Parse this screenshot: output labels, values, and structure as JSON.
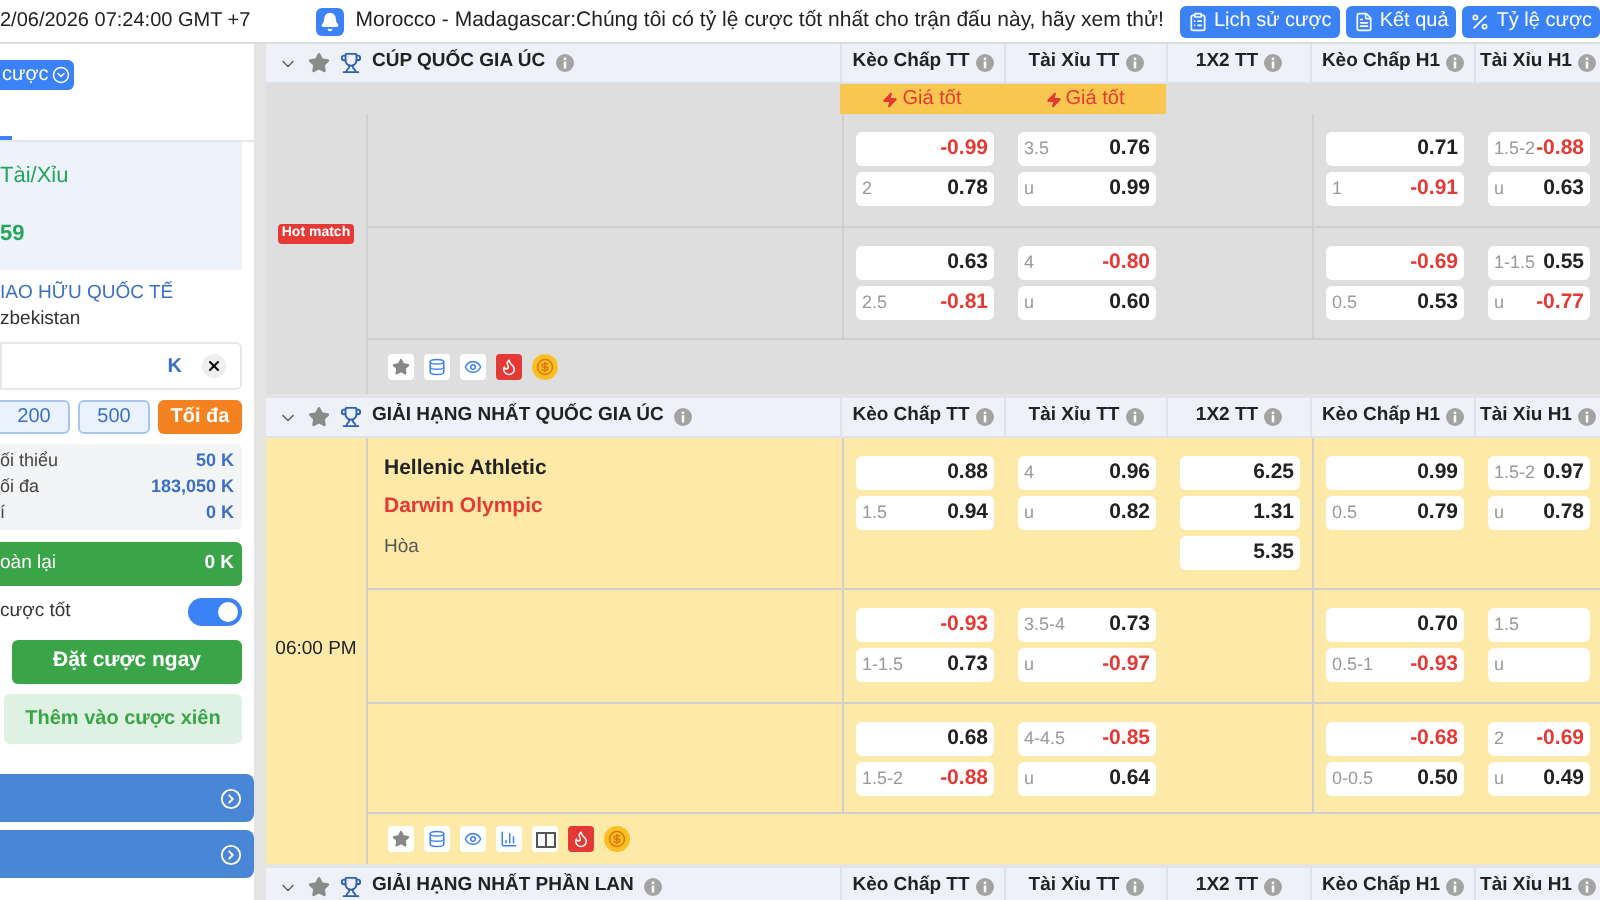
{
  "top_bar": {
    "datetime": "2/06/2026 07:24:00 GMT +7",
    "notice": "Morocco - Madagascar:Chúng tôi có tỷ lệ cược tốt nhất cho trận đấu này, hãy xem thử!",
    "buttons": [
      {
        "label": "Lịch sử cược",
        "kind": "history"
      },
      {
        "label": "Kết quả",
        "kind": "results"
      },
      {
        "label": "Tỷ lệ cược",
        "kind": "odds"
      }
    ]
  },
  "sidebar": {
    "slip_button": "cược",
    "bet": {
      "market": "Tài/Xỉu",
      "odds": "59",
      "league": "IAO HỮU QUỐC TẾ",
      "team": "zbekistan"
    },
    "stake": {
      "unit": "K"
    },
    "quick_amounts": [
      "200",
      "500"
    ],
    "max_button": "Tối đa",
    "limits": [
      {
        "label": "ối thiểu",
        "value": "50 K"
      },
      {
        "label": "ối đa",
        "value": "183,050 K"
      },
      {
        "label": "í",
        "value": "0 K"
      }
    ],
    "refund": {
      "label": "oàn lại",
      "value": "0 K"
    },
    "accept_better": {
      "label": "cược tốt",
      "on": true
    },
    "place_button": "Đặt cược ngay",
    "parlay_button": "Thêm vào cược xiên"
  },
  "leagues": [
    {
      "name": "CÚP QUỐC GIA ÚC",
      "columns": [
        {
          "label": "Kèo Chấp TT",
          "badge": "Giá tốt"
        },
        {
          "label": "Tài Xỉu TT",
          "badge": "Giá tốt"
        },
        {
          "label": "1X2 TT"
        },
        {
          "label": "Kèo Chấp H1"
        },
        {
          "label": "Tài Xỉu H1"
        }
      ],
      "match": {
        "highlighted": false,
        "badge": "Hot match",
        "rows": [
          [
            [
              {
                "value": "-0.99",
                "negative": true
              },
              {
                "line": "2",
                "value": "0.78",
                "negative": false
              }
            ],
            [
              {
                "line": "3.5",
                "value": "0.76",
                "negative": false
              },
              {
                "line": "u",
                "value": "0.99",
                "negative": false
              }
            ],
            [],
            [
              {
                "value": "0.71",
                "negative": false
              },
              {
                "line": "1",
                "value": "-0.91",
                "negative": true
              }
            ],
            [
              {
                "line": "1.5-2",
                "value": "-0.88",
                "negative": true
              },
              {
                "line": "u",
                "value": "0.63",
                "negative": false
              }
            ]
          ],
          [
            [
              {
                "value": "0.63",
                "negative": false
              },
              {
                "line": "2.5",
                "value": "-0.81",
                "negative": true
              }
            ],
            [
              {
                "line": "4",
                "value": "-0.80",
                "negative": true
              },
              {
                "line": "u",
                "value": "0.60",
                "negative": false
              }
            ],
            [],
            [
              {
                "value": "-0.69",
                "negative": true
              },
              {
                "line": "0.5",
                "value": "0.53",
                "negative": false
              }
            ],
            [
              {
                "line": "1-1.5",
                "value": "0.55",
                "negative": false
              },
              {
                "line": "u",
                "value": "-0.77",
                "negative": true
              }
            ]
          ]
        ],
        "tools": [
          {
            "kind": "favorite"
          },
          {
            "kind": "data"
          },
          {
            "kind": "watch"
          },
          {
            "kind": "hot"
          },
          {
            "kind": "bonus"
          }
        ]
      }
    },
    {
      "name": "GIẢI HẠNG NHẤT QUỐC GIA ÚC",
      "columns": [
        {
          "label": "Kèo Chấp TT"
        },
        {
          "label": "Tài Xỉu TT"
        },
        {
          "label": "1X2 TT"
        },
        {
          "label": "Kèo Chấp H1"
        },
        {
          "label": "Tài Xỉu H1"
        }
      ],
      "match": {
        "highlighted": true,
        "time": "06:00 PM",
        "teams": [
          {
            "name": "Hellenic Athletic",
            "kind": "home"
          },
          {
            "name": "Darwin Olympic",
            "kind": "away"
          },
          {
            "name": "Hòa",
            "kind": "draw"
          }
        ],
        "rows": [
          [
            [
              {
                "value": "0.88",
                "negative": false
              },
              {
                "line": "1.5",
                "value": "0.94",
                "negative": false
              }
            ],
            [
              {
                "line": "4",
                "value": "0.96",
                "negative": false
              },
              {
                "line": "u",
                "value": "0.82",
                "negative": false
              }
            ],
            [
              {
                "value": "6.25",
                "negative": false
              },
              {
                "value": "1.31",
                "negative": false
              },
              {
                "value": "5.35",
                "negative": false
              }
            ],
            [
              {
                "value": "0.99",
                "negative": false
              },
              {
                "line": "0.5",
                "value": "0.79",
                "negative": false
              }
            ],
            [
              {
                "line": "1.5-2",
                "value": "0.97",
                "negative": false
              },
              {
                "line": "u",
                "value": "0.78",
                "negative": false
              }
            ]
          ],
          [
            [
              {
                "value": "-0.93",
                "negative": true
              },
              {
                "line": "1-1.5",
                "value": "0.73",
                "negative": false
              }
            ],
            [
              {
                "line": "3.5-4",
                "value": "0.73",
                "negative": false
              },
              {
                "line": "u",
                "value": "-0.97",
                "negative": true
              }
            ],
            [],
            [
              {
                "value": "0.70",
                "negative": false
              },
              {
                "line": "0.5-1",
                "value": "-0.93",
                "negative": true
              }
            ],
            [
              {
                "line": "1.5"
              },
              {
                "line": "u"
              }
            ]
          ],
          [
            [
              {
                "value": "0.68",
                "negative": false
              },
              {
                "line": "1.5-2",
                "value": "-0.88",
                "negative": true
              }
            ],
            [
              {
                "line": "4-4.5",
                "value": "-0.85",
                "negative": true
              },
              {
                "line": "u",
                "value": "0.64",
                "negative": false
              }
            ],
            [],
            [
              {
                "value": "-0.68",
                "negative": true
              },
              {
                "line": "0-0.5",
                "value": "0.50",
                "negative": false
              }
            ],
            [
              {
                "line": "2",
                "value": "-0.69",
                "negative": true
              },
              {
                "line": "u",
                "value": "0.49",
                "negative": false
              }
            ]
          ]
        ],
        "tools": [
          {
            "kind": "favorite"
          },
          {
            "kind": "data"
          },
          {
            "kind": "watch"
          },
          {
            "kind": "stats"
          },
          {
            "kind": "lineup"
          },
          {
            "kind": "hot"
          },
          {
            "kind": "bonus"
          }
        ]
      }
    },
    {
      "name": "GIẢI HẠNG NHẤT PHẦN LAN",
      "columns": [
        {
          "label": "Kèo Chấp TT"
        },
        {
          "label": "Tài Xỉu TT"
        },
        {
          "label": "1X2 TT"
        },
        {
          "label": "Kèo Chấp H1"
        },
        {
          "label": "Tài Xỉu H1"
        }
      ]
    }
  ]
}
